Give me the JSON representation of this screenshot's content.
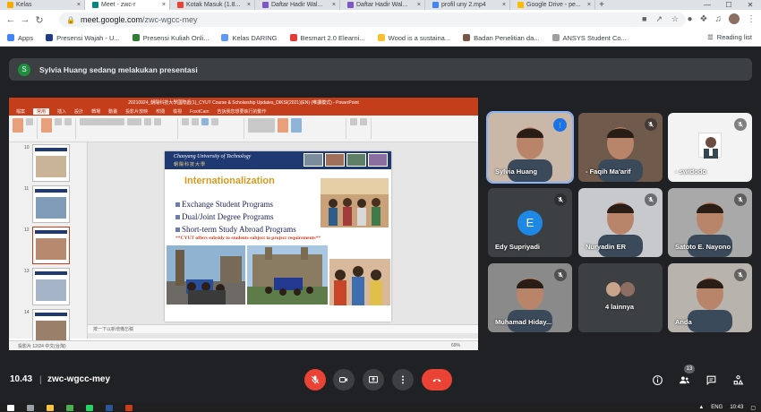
{
  "browser": {
    "tabs": [
      {
        "title": "Kelas",
        "color": "#f9ab00"
      },
      {
        "title": "Meet - zwc-r",
        "color": "#00897b",
        "active": true
      },
      {
        "title": "Kotak Masuk (1.8...",
        "color": "#ea4335"
      },
      {
        "title": "Daftar Hadir Wal...",
        "color": "#7e57c2"
      },
      {
        "title": "Daftar Hadir Wal...",
        "color": "#7e57c2"
      },
      {
        "title": "profil uny 2.mp4",
        "color": "#4285f4"
      },
      {
        "title": "Google Drive - pe...",
        "color": "#fbbc04"
      }
    ],
    "url_domain": "meet.google.com",
    "url_path": "/zwc-wgcc-mey",
    "bookmarks": [
      {
        "label": "Apps",
        "color": "#4285f4"
      },
      {
        "label": "Presensi Wajah - U...",
        "color": "#1e3a8a"
      },
      {
        "label": "Presensi Kuliah Onli...",
        "color": "#2e7d32"
      },
      {
        "label": "Kelas DARING",
        "color": "#5e97f6"
      },
      {
        "label": "Besmart 2.0 Elearni...",
        "color": "#e53935"
      },
      {
        "label": "Wood is a sustaina...",
        "color": "#fbc02d"
      },
      {
        "label": "Badan Penelitian da...",
        "color": "#795548"
      },
      {
        "label": "ANSYS Student Co...",
        "color": "#9e9e9e"
      }
    ],
    "reading_list": "Reading list"
  },
  "meet": {
    "banner_initial": "S",
    "banner_text": "Sylvia Huang sedang melakukan presentasi",
    "time": "10.43",
    "separator": "|",
    "meeting_code": "zwc-wgcc-mey",
    "participant_count": "13",
    "participants": [
      {
        "name": "Sylvia Huang",
        "active": true
      },
      {
        "name": "- Faqih Ma'arif"
      },
      {
        "name": "- swidodo"
      },
      {
        "name": "Edy Supriyadi",
        "initial": "E"
      },
      {
        "name": "Nuryadin ER"
      },
      {
        "name": "Satoto E. Nayono"
      },
      {
        "name": "Muhamad Hiday..."
      },
      {
        "name": "4 lainnya"
      },
      {
        "name": "Anda"
      }
    ]
  },
  "powerpoint": {
    "title_bar": "20210924_朝陽科技大學國際處(1)_CYUT Course & Scholarship Updates_DIKSI(2021)(EN) (唯讀模式) - PowerPoint",
    "ribbon_tabs": [
      "檔案",
      "常用",
      "插入",
      "設計",
      "轉場",
      "動畫",
      "投影片放映",
      "校閱",
      "檢視",
      "FoxitCam",
      "告訴我您想要執行的動作"
    ],
    "notes_placeholder": "按一下以新增備忘稿",
    "status_left": "投影片 12/24   中文(台灣)",
    "zoom": "69%",
    "slide_numbers": [
      "10",
      "11",
      "12",
      "13",
      "14"
    ],
    "slide": {
      "university": "Chaoyang University of Technology",
      "university_zh": "朝陽科技大學",
      "title": "Internationalization",
      "bullets": [
        "Exchange Student Programs",
        "Dual/Joint Degree Programs",
        "Short-term Study Abroad Programs"
      ],
      "note": "**CYUT offers subsidy to students subject to project requirements**"
    }
  },
  "windows": {
    "lang": "ENG",
    "time": "10:43"
  }
}
